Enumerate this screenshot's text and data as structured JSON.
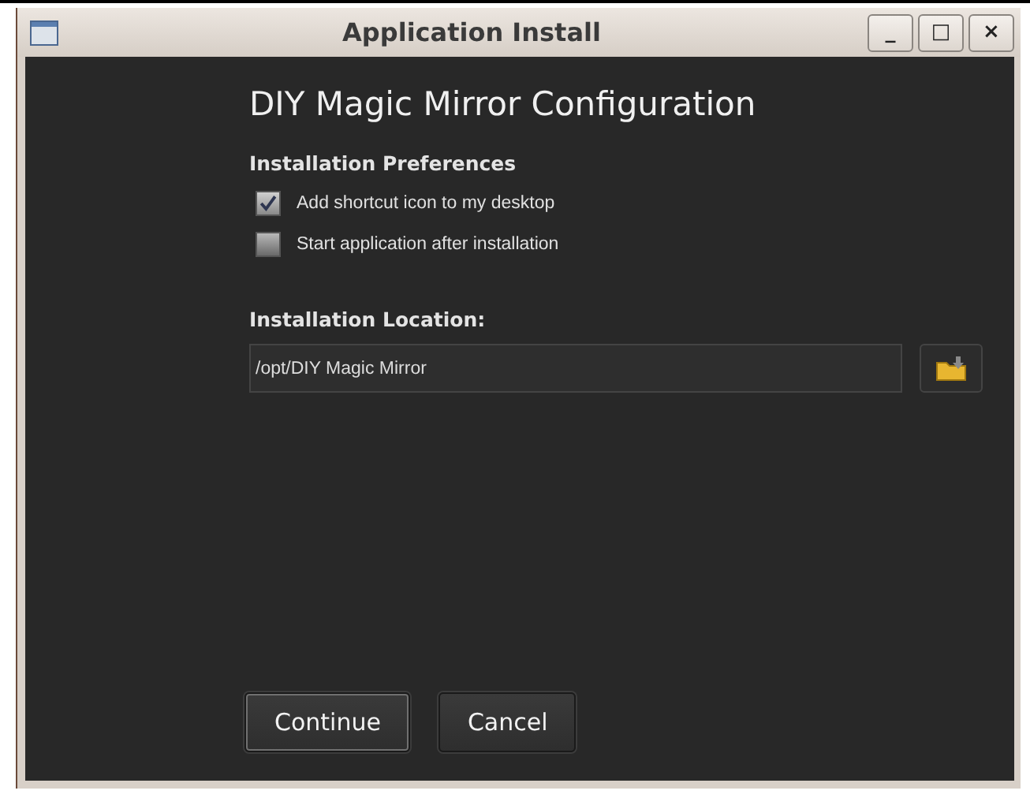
{
  "window": {
    "title": "Application Install",
    "controls": [
      "_",
      "□",
      "×"
    ]
  },
  "heading": "DIY Magic Mirror Configuration",
  "preferences": {
    "title": "Installation Preferences",
    "options": [
      {
        "label": "Add shortcut icon to my desktop",
        "checked": true
      },
      {
        "label": "Start application after installation",
        "checked": false
      }
    ]
  },
  "location": {
    "label": "Installation Location:",
    "value": "/opt/DIY Magic Mirror"
  },
  "buttons": [
    {
      "label": "Continue",
      "selected": true
    },
    {
      "label": "Cancel",
      "selected": false
    }
  ]
}
